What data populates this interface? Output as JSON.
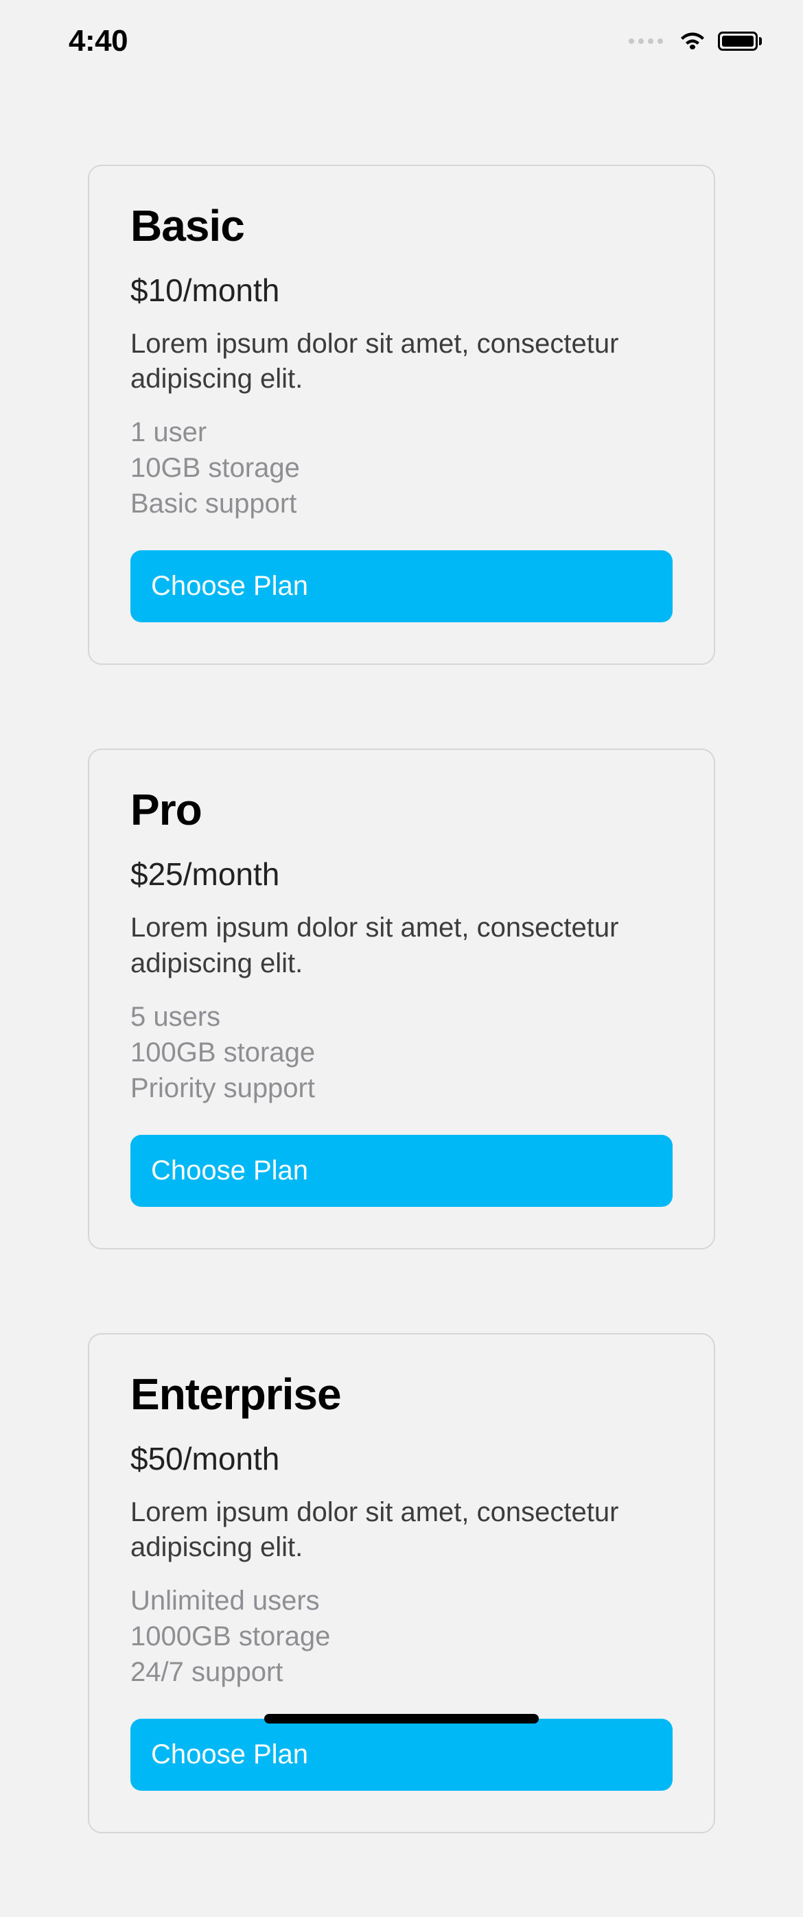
{
  "status_bar": {
    "time": "4:40"
  },
  "plans": [
    {
      "title": "Basic",
      "price": "$10/month",
      "description": "Lorem ipsum dolor sit amet, consectetur adipiscing elit.",
      "features": [
        "1 user",
        "10GB storage",
        "Basic support"
      ],
      "button_label": "Choose Plan"
    },
    {
      "title": "Pro",
      "price": "$25/month",
      "description": "Lorem ipsum dolor sit amet, consectetur adipiscing elit.",
      "features": [
        "5 users",
        "100GB storage",
        "Priority support"
      ],
      "button_label": "Choose Plan"
    },
    {
      "title": "Enterprise",
      "price": "$50/month",
      "description": "Lorem ipsum dolor sit amet, consectetur adipiscing elit.",
      "features": [
        "Unlimited users",
        "1000GB storage",
        "24/7 support"
      ],
      "button_label": "Choose Plan"
    }
  ]
}
